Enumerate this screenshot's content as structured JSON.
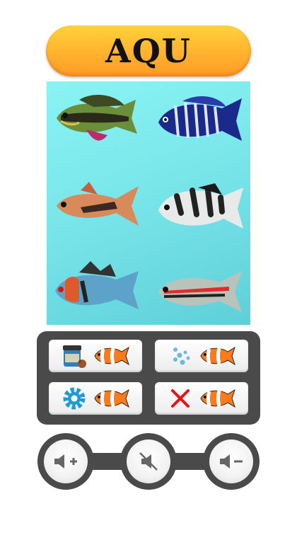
{
  "header": {
    "title": "AQU"
  },
  "tank": {
    "fish": [
      {
        "name": "kribensis-fish-icon"
      },
      {
        "name": "zebra-cichlid-fish-icon"
      },
      {
        "name": "rasbora-fish-icon"
      },
      {
        "name": "archer-fish-icon"
      },
      {
        "name": "ram-cichlid-fish-icon"
      },
      {
        "name": "redline-tetra-fish-icon"
      }
    ]
  },
  "controls": {
    "buttons": [
      {
        "id": "feed",
        "icon": "fish-food-jar-icon"
      },
      {
        "id": "bubbles",
        "icon": "bubbles-icon"
      },
      {
        "id": "settings",
        "icon": "gear-icon"
      },
      {
        "id": "remove",
        "icon": "red-x-icon"
      }
    ],
    "accent_blue": "#1e9bd7",
    "accent_red": "#e01515"
  },
  "sound": {
    "buttons": [
      "volume-up-icon",
      "mute-icon",
      "volume-down-icon"
    ]
  }
}
